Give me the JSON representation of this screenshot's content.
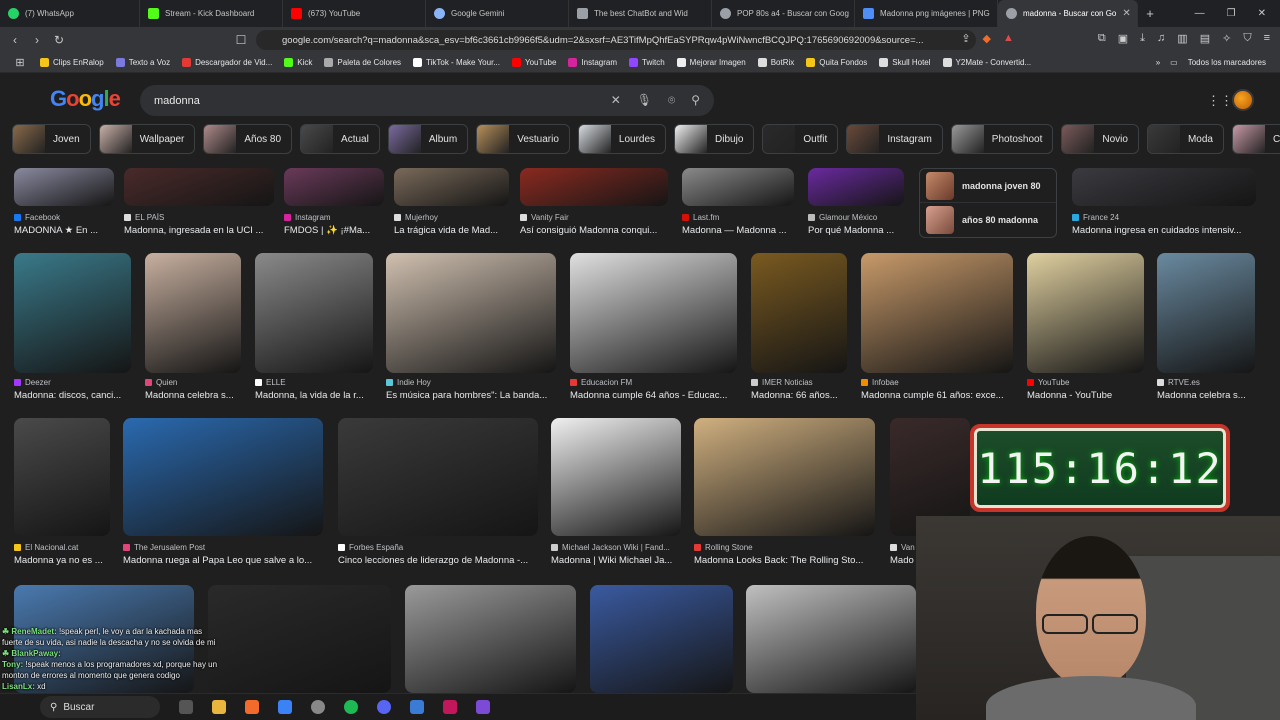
{
  "tabs": [
    {
      "title": "(7) WhatsApp",
      "color": "#25d366"
    },
    {
      "title": "Stream - Kick Dashboard",
      "color": "#53fc18"
    },
    {
      "title": "(673) YouTube",
      "color": "#ff0000"
    },
    {
      "title": "Google Gemini",
      "color": "#8ab4f8"
    },
    {
      "title": "The best ChatBot and Wid",
      "color": "#9aa0a6"
    },
    {
      "title": "POP 80s a4 - Buscar con Goog",
      "color": "#9aa0a6"
    },
    {
      "title": "Madonna png imágenes | PNG",
      "color": "#4f8ef7"
    },
    {
      "title": "madonna - Buscar con Go",
      "color": "#9aa0a6"
    }
  ],
  "address": {
    "url": "google.com/search?q=madonna&sca_esv=bf6c3661cb9966f5&udm=2&sxsrf=AE3TifMpQhfEaSYPRqw4pWiNwncfBCQJPQ:1765690692009&source=..."
  },
  "bookmarks": [
    {
      "label": "Clips EnRalop",
      "color": "#f5c518"
    },
    {
      "label": "Texto a Voz",
      "color": "#7a7adf"
    },
    {
      "label": "Descargador de Vid...",
      "color": "#e53935"
    },
    {
      "label": "Kick",
      "color": "#53fc18"
    },
    {
      "label": "Paleta de Colores",
      "color": "#aaaaaa"
    },
    {
      "label": "TikTok - Make Your...",
      "color": "#ffffff"
    },
    {
      "label": "YouTube",
      "color": "#ff0000"
    },
    {
      "label": "Instagram",
      "color": "#d6249f"
    },
    {
      "label": "Twitch",
      "color": "#9146ff"
    },
    {
      "label": "Mejorar Imagen",
      "color": "#eeeeee"
    },
    {
      "label": "BotRix",
      "color": "#dddddd"
    },
    {
      "label": "Quita Fondos",
      "color": "#f5c518"
    },
    {
      "label": "Skull Hotel",
      "color": "#dddddd"
    },
    {
      "label": "Y2Mate - Convertid...",
      "color": "#dddddd"
    }
  ],
  "bookmarks_all": "Todos los marcadores",
  "search": {
    "logo": "Google",
    "query": "madonna"
  },
  "chips": [
    {
      "label": "Joven",
      "c": "#8a6a4a"
    },
    {
      "label": "Wallpaper",
      "c": "#c9b0a8"
    },
    {
      "label": "Años 80",
      "c": "#b08a8a"
    },
    {
      "label": "Actual",
      "c": "#4a4a4a"
    },
    {
      "label": "Album",
      "c": "#7a6aa0"
    },
    {
      "label": "Vestuario",
      "c": "#b8905a"
    },
    {
      "label": "Lourdes",
      "c": "#d8dce0"
    },
    {
      "label": "Dibujo",
      "c": "#f0f0f0"
    },
    {
      "label": "Outfit",
      "c": "#2a2a2a"
    },
    {
      "label": "Instagram",
      "c": "#6a4a3a"
    },
    {
      "label": "Photoshoot",
      "c": "#9a9a9a"
    },
    {
      "label": "Novio",
      "c": "#7a5a5a"
    },
    {
      "label": "Moda",
      "c": "#3a3a3a"
    },
    {
      "label": "Cantante",
      "c": "#c89aa8"
    }
  ],
  "row1": [
    {
      "src": "Facebook",
      "title": "MADONNA ★ En ...",
      "c": "#1877f2"
    },
    {
      "src": "EL PAÍS",
      "title": "Madonna, ingresada en la UCI ...",
      "c": "#dddddd"
    },
    {
      "src": "Instagram",
      "title": "FMDOS | ✨ ¡#Ma...",
      "c": "#d6249f"
    },
    {
      "src": "Mujerhoy",
      "title": "La trágica vida de Mad...",
      "c": "#dddddd"
    },
    {
      "src": "Vanity Fair",
      "title": "Así consiguió Madonna conqui...",
      "c": "#dddddd"
    },
    {
      "src": "Last.fm",
      "title": "Madonna — Madonna ...",
      "c": "#d51007"
    },
    {
      "src": "Glamour México",
      "title": "Por qué Madonna ...",
      "c": "#bbbbbb"
    },
    {
      "src": "France 24",
      "title": "Madonna ingresa en cuidados intensiv...",
      "c": "#29a9e0"
    }
  ],
  "suggestions": [
    {
      "label": "madonna joven 80"
    },
    {
      "label": "años 80 madonna"
    }
  ],
  "row2": [
    {
      "src": "Deezer",
      "title": "Madonna: discos, canci...",
      "c": "#a238ff"
    },
    {
      "src": "Quien",
      "title": "Madonna celebra s...",
      "c": "#e0457b"
    },
    {
      "src": "ELLE",
      "title": "Madonna, la vida de la r...",
      "c": "#ffffff"
    },
    {
      "src": "Indie Hoy",
      "title": "Es música para hombres\": La banda...",
      "c": "#5ac8d8"
    },
    {
      "src": "Educacion FM",
      "title": "Madonna cumple 64 años - Educac...",
      "c": "#e53935"
    },
    {
      "src": "IMER Noticias",
      "title": "Madonna: 66 años...",
      "c": "#cccccc"
    },
    {
      "src": "Infobae",
      "title": "Madonna cumple 61 años: exce...",
      "c": "#f08c00"
    },
    {
      "src": "YouTube",
      "title": "Madonna - YouTube",
      "c": "#ff0000"
    },
    {
      "src": "RTVE.es",
      "title": "Madonna celebra s...",
      "c": "#dddddd"
    }
  ],
  "row3": [
    {
      "src": "El Nacional.cat",
      "title": "Madonna ya no es ...",
      "c": "#f5c518"
    },
    {
      "src": "The Jerusalem Post",
      "title": "Madonna ruega al Papa Leo que salve a lo...",
      "c": "#e0457b"
    },
    {
      "src": "Forbes España",
      "title": "Cinco lecciones de liderazgo de Madonna -...",
      "c": "#ffffff"
    },
    {
      "src": "Michael Jackson Wiki | Fand...",
      "title": "Madonna | Wiki Michael Ja...",
      "c": "#cccccc"
    },
    {
      "src": "Rolling Stone",
      "title": "Madonna Looks Back: The Rolling Sto...",
      "c": "#e53935"
    },
    {
      "src": "Van",
      "title": "Mado",
      "c": "#dddddd"
    }
  ],
  "timer": "115:16:12",
  "chat": [
    {
      "name": "☘ ReneMadet:",
      "msg": " !speak perl, le voy a dar la kachada mas fuerte de su vida, asi nadie la descacha y no se olvida de mi"
    },
    {
      "name": "☘ BlankPaway:",
      "msg": ""
    },
    {
      "name": "Tony:",
      "msg": " !speak menos a los programadores xd, porque hay un monton de errores al momento que genera codigo"
    },
    {
      "name": "LisanLx:",
      "msg": " xd"
    }
  ],
  "taskbar": {
    "search": "Buscar"
  }
}
